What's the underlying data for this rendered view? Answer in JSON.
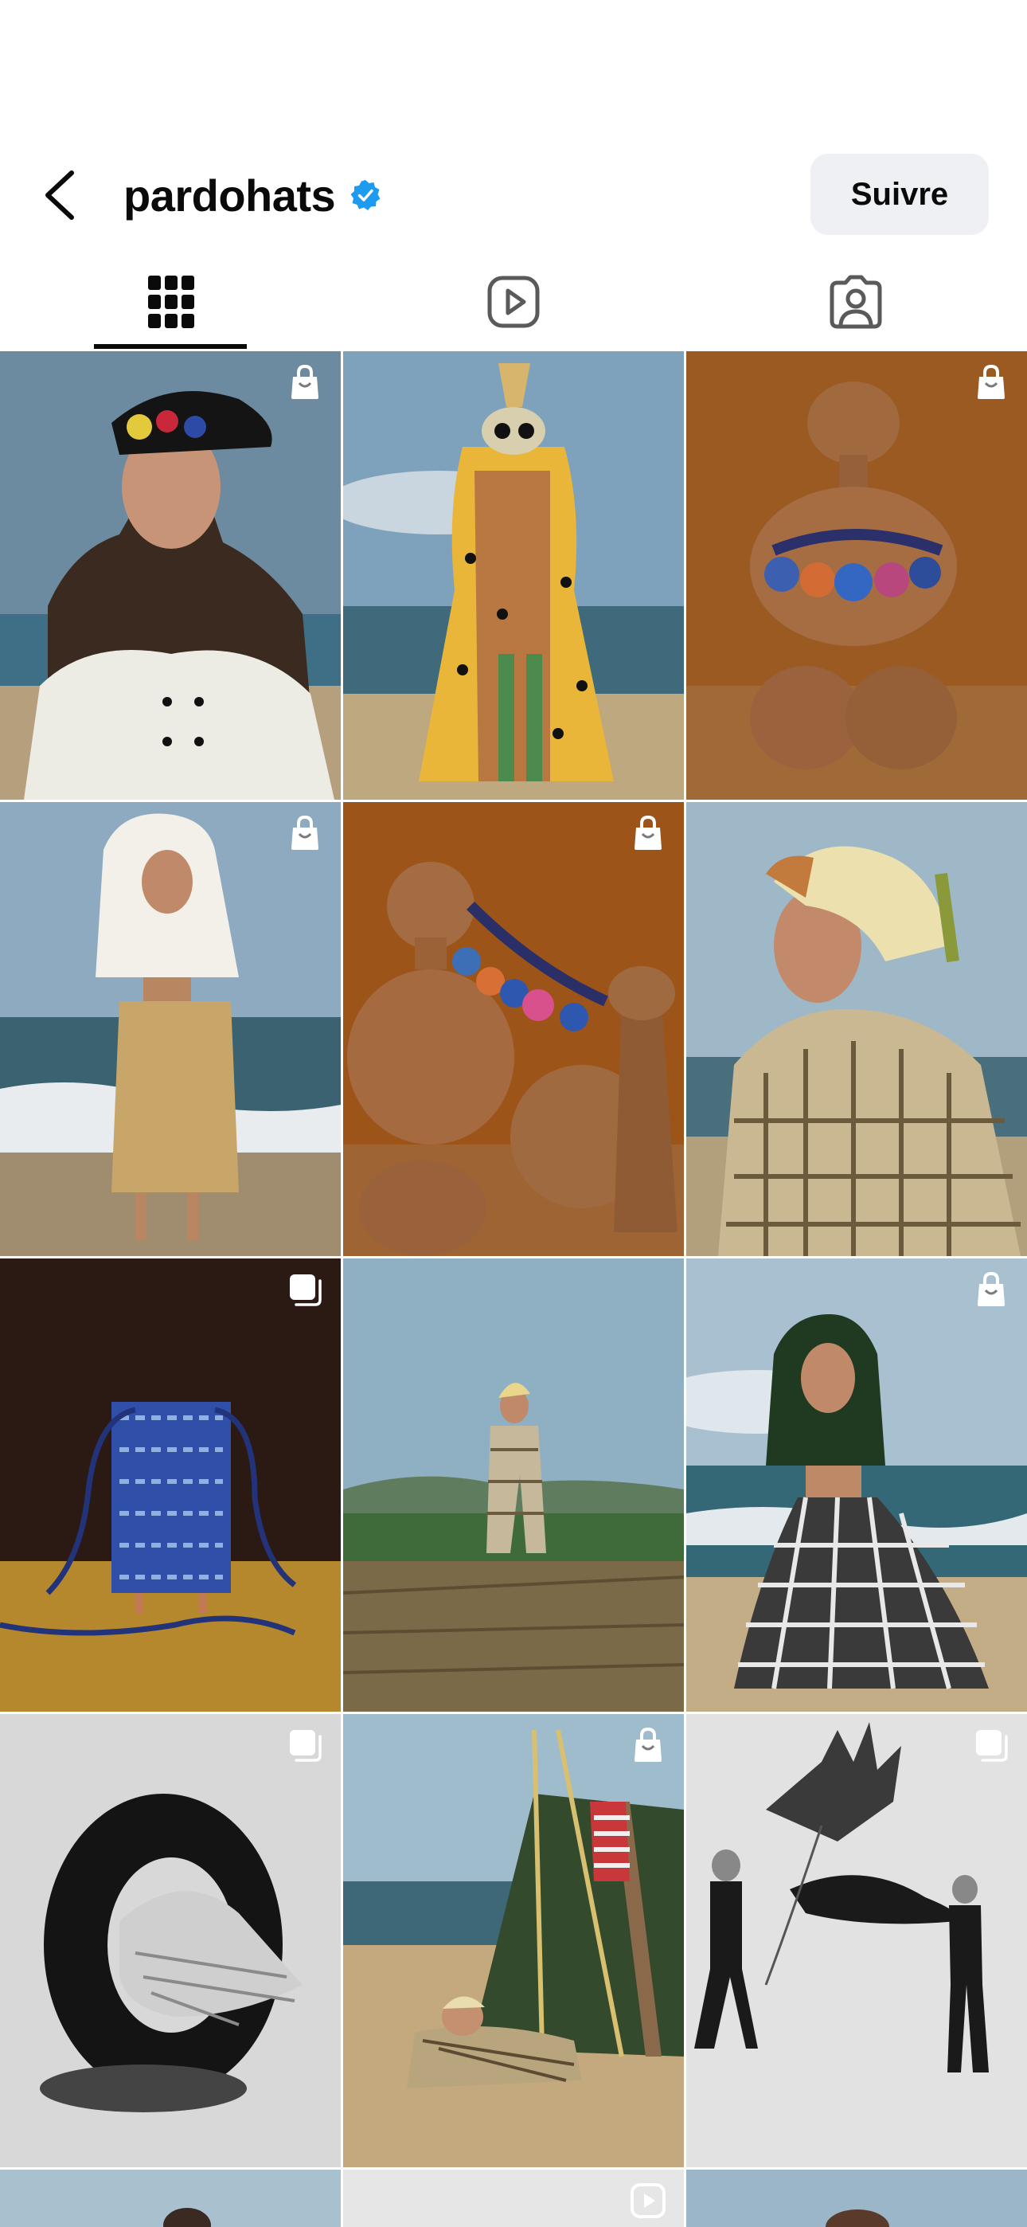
{
  "header": {
    "back_icon": "chevron-left-icon",
    "username": "pardohats",
    "verified_icon": "verified-badge-icon",
    "verified_color": "#1d9bf0",
    "follow_label": "Suivre"
  },
  "tabs": [
    {
      "icon": "grid-icon",
      "active": true
    },
    {
      "icon": "reels-icon",
      "active": false
    },
    {
      "icon": "tagged-icon",
      "active": false
    }
  ],
  "posts": [
    {
      "subject": "woman-black-beret-white-coat-beach",
      "badge": "shopping-bag-icon"
    },
    {
      "subject": "costume-figure-polka-dot-beach",
      "badge": ""
    },
    {
      "subject": "clay-sculpture-beaded-necklace-brown",
      "badge": "shopping-bag-icon"
    },
    {
      "subject": "woman-white-hood-raffia-skirt-beach",
      "badge": "shopping-bag-icon"
    },
    {
      "subject": "clay-vases-colorful-beads",
      "badge": "shopping-bag-icon"
    },
    {
      "subject": "man-knit-hat-plaid-coat",
      "badge": ""
    },
    {
      "subject": "blue-woven-bag-tassels",
      "badge": "carousel-icon"
    },
    {
      "subject": "figure-plaid-suit-field",
      "badge": ""
    },
    {
      "subject": "woman-green-hood-plaid-pants-beach",
      "badge": "shopping-bag-icon"
    },
    {
      "subject": "tire-straw-hat-black-white",
      "badge": "carousel-icon"
    },
    {
      "subject": "tent-beach-person-lying",
      "badge": "shopping-bag-icon"
    },
    {
      "subject": "dancers-kite-black-white",
      "badge": "carousel-icon"
    },
    {
      "subject": "partial-post-1",
      "badge": ""
    },
    {
      "subject": "partial-post-2",
      "badge": "reels-play-icon"
    },
    {
      "subject": "partial-post-3",
      "badge": ""
    }
  ]
}
